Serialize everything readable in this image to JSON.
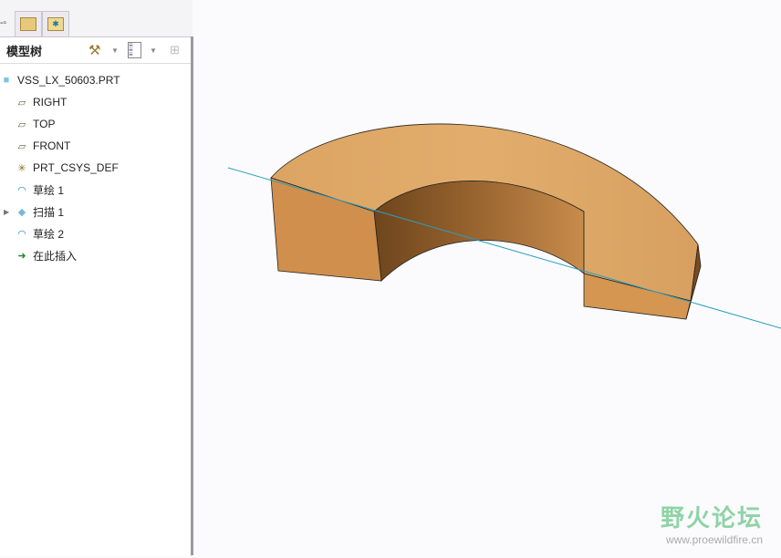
{
  "tabs": [
    {
      "name": "model-tree-tab",
      "icon": "tree-icon"
    },
    {
      "name": "folder-browser-tab",
      "icon": "folders-icon"
    },
    {
      "name": "favorites-tab",
      "icon": "favorites-folder-icon"
    }
  ],
  "panel": {
    "title": "模型树"
  },
  "tree": [
    {
      "label": "VSS_LX_50603.PRT",
      "icon": "part-icon"
    },
    {
      "label": "RIGHT",
      "icon": "datum-plane-icon"
    },
    {
      "label": "TOP",
      "icon": "datum-plane-icon"
    },
    {
      "label": "FRONT",
      "icon": "datum-plane-icon"
    },
    {
      "label": "PRT_CSYS_DEF",
      "icon": "csys-icon"
    },
    {
      "label": "草绘 1",
      "icon": "sketch-icon"
    },
    {
      "label": "扫描 1",
      "icon": "sweep-icon",
      "expandable": true
    },
    {
      "label": "草绘 2",
      "icon": "sketch-icon"
    },
    {
      "label": "在此插入",
      "icon": "insert-arrow-icon"
    }
  ],
  "watermark": {
    "title": "野火论坛",
    "url": "www.proewildfire.cn"
  },
  "colors": {
    "wood": "#d9a060",
    "axis": "#2a9fc0"
  }
}
